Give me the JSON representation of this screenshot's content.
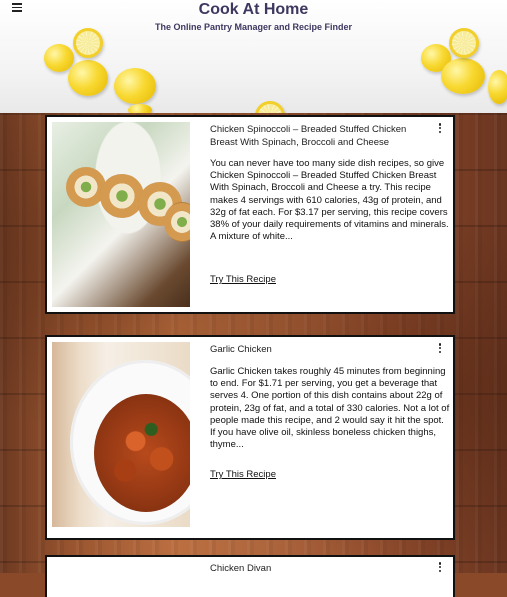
{
  "header": {
    "title": "Cook At Home",
    "subtitle": "The Online Pantry Manager and Recipe Finder"
  },
  "recipes": [
    {
      "title": "Chicken Spinoccoli – Breaded Stuffed Chicken Breast With Spinach, Broccoli and Cheese",
      "description": "You can never have too many side dish recipes, so give Chicken Spinoccoli – Breaded Stuffed Chicken Breast With Spinach, Broccoli and Cheese a try. This recipe makes 4 servings with 610 calories, 43g of protein, and 32g of fat each. For $3.17 per serving, this recipe covers 38% of your daily requirements of vitamins and minerals. A mixture of white...",
      "link_label": "Try This Recipe",
      "image_icon": "stuffed-chicken-rolls-image"
    },
    {
      "title": "Garlic Chicken",
      "description": "Garlic Chicken takes roughly 45 minutes from beginning to end. For $1.71 per serving, you get a beverage that serves 4. One portion of this dish contains about 22g of protein, 23g of fat, and a total of 330 calories. Not a lot of people made this recipe, and 2 would say it hit the spot. If you have olive oil, skinless boneless chicken thighs, thyme...",
      "link_label": "Try This Recipe",
      "image_icon": "garlic-chicken-bowl-image"
    },
    {
      "title": "Chicken Divan"
    }
  ],
  "colors": {
    "brand": "#3d3860",
    "card_border": "#111111"
  }
}
